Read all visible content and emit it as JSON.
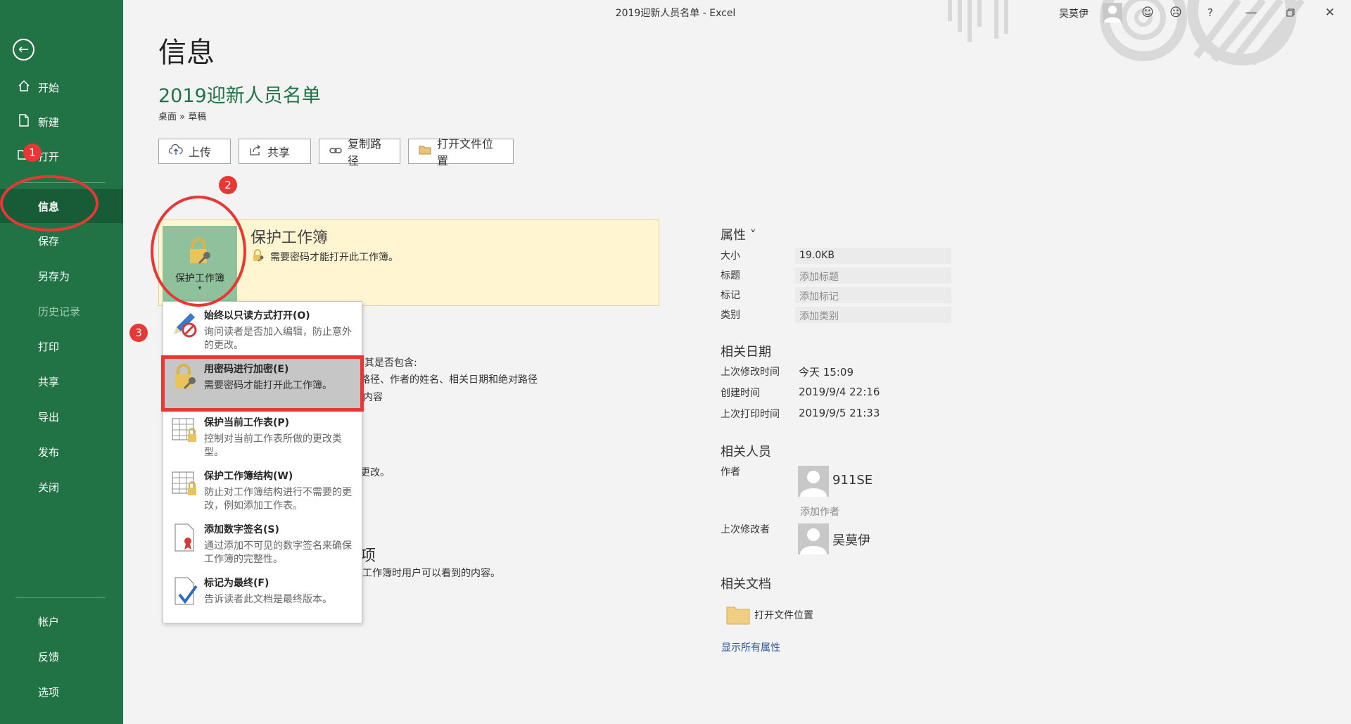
{
  "window": {
    "title": "2019迎新人员名单  -  Excel",
    "user": "吴莫伊",
    "help": "?"
  },
  "sidebar": {
    "items": [
      {
        "label": "开始",
        "icon": "home-icon"
      },
      {
        "label": "新建",
        "icon": "new-file-icon"
      },
      {
        "label": "打开",
        "icon": "open-folder-icon"
      },
      {
        "label": "信息"
      },
      {
        "label": "保存"
      },
      {
        "label": "另存为"
      },
      {
        "label": "历史记录"
      },
      {
        "label": "打印"
      },
      {
        "label": "共享"
      },
      {
        "label": "导出"
      },
      {
        "label": "发布"
      },
      {
        "label": "关闭"
      },
      {
        "label": "帐户"
      },
      {
        "label": "反馈"
      },
      {
        "label": "选项"
      }
    ]
  },
  "main": {
    "page_title": "信息",
    "doc_title": "2019迎新人员名单",
    "path": "桌面 » 草稿",
    "buttons": [
      "上传",
      "共享",
      "复制路径",
      "打开文件位置"
    ],
    "protect": {
      "button_label": "保护工作簿",
      "heading": "保护工作簿",
      "description": "需要密码才能打开此工作簿。"
    },
    "obscured_text": [
      "意其是否包含:",
      "路径、作者的姓名、相关日期和绝对路径",
      "内容",
      "更改。",
      "工作簿时用户可以看到的内容。"
    ]
  },
  "menu": {
    "items": [
      {
        "title": "始终以只读方式打开(O)",
        "desc": "询问读者是否加入编辑，防止意外的更改。"
      },
      {
        "title": "用密码进行加密(E)",
        "desc": "需要密码才能打开此工作簿。"
      },
      {
        "title": "保护当前工作表(P)",
        "desc": "控制对当前工作表所做的更改类型。"
      },
      {
        "title": "保护工作簿结构(W)",
        "desc": "防止对工作簿结构进行不需要的更改，例如添加工作表。"
      },
      {
        "title": "添加数字签名(S)",
        "desc": "通过添加不可见的数字签名来确保工作簿的完整性。"
      },
      {
        "title": "标记为最终(F)",
        "desc": "告诉读者此文档是最终版本。"
      }
    ]
  },
  "annotations": [
    "1",
    "2",
    "3"
  ],
  "properties": {
    "heading": "属性 ˅",
    "rows": [
      {
        "label": "大小",
        "value": "19.0KB"
      },
      {
        "label": "标题",
        "value": "添加标题"
      },
      {
        "label": "标记",
        "value": "添加标记"
      },
      {
        "label": "类别",
        "value": "添加类别"
      }
    ],
    "dates_heading": "相关日期",
    "dates": [
      {
        "label": "上次修改时间",
        "value": "今天 15:09"
      },
      {
        "label": "创建时间",
        "value": "2019/9/4 22:16"
      },
      {
        "label": "上次打印时间",
        "value": "2019/9/5 21:33"
      }
    ],
    "people_heading": "相关人员",
    "author_label": "作者",
    "author_name": "911SE",
    "add_author": "添加作者",
    "last_modified_by_label": "上次修改者",
    "last_modified_by": "吴莫伊",
    "docs_heading": "相关文档",
    "open_location": "打开文件位置",
    "show_all": "显示所有属性"
  },
  "colors": {
    "brand": "#217346",
    "sidebar_active": "#185c37",
    "annotation": "#e53935",
    "protect_panel": "#fff5d0"
  }
}
